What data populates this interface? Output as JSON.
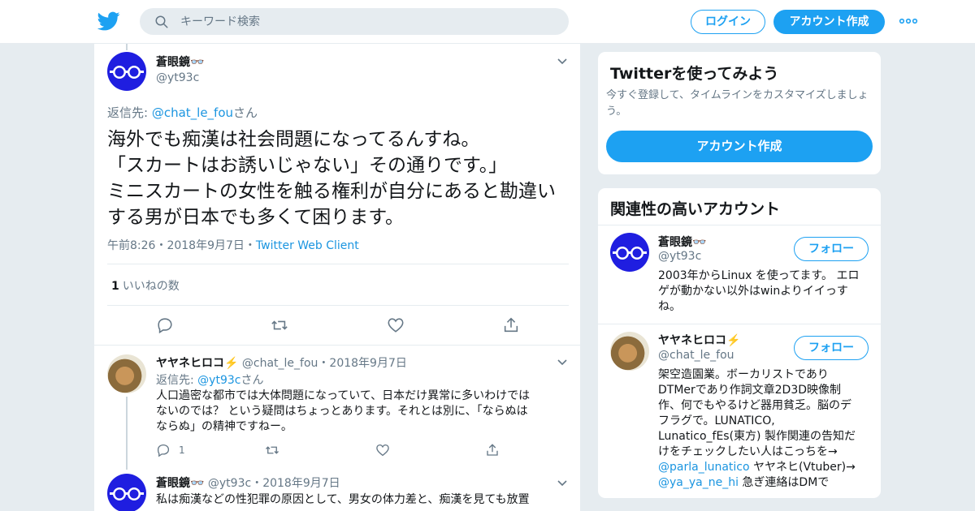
{
  "header": {
    "logo_icon": "twitter-bird-icon",
    "search_placeholder": "キーワード検索",
    "login_label": "ログイン",
    "signup_label": "アカウント作成",
    "more_icon": "more-dots-icon",
    "brand_color": "#1da1f2"
  },
  "tweet": {
    "author_name": "蒼眼鏡👓",
    "author_handle": "@yt93c",
    "reply_prefix": "返信先: ",
    "reply_to": "@chat_le_fou",
    "reply_suffix": "さん",
    "lines": [
      "海外でも痴漢は社会問題になってるんすね。",
      "「スカートはお誘いじゃない」その通りです。」",
      "ミニスカートの女性を触る権利が自分にあると勘違い",
      "する男が日本でも多くて困ります。"
    ],
    "time": "午前8:26",
    "date": "2018年9月7日",
    "dot": "・",
    "client": "Twitter Web Client",
    "likes_count": "1",
    "likes_label": "いいねの数"
  },
  "replies": [
    {
      "author_name": "ヤヤネヒロコ⚡️",
      "author_handle": "@chat_le_fou",
      "dot": "・",
      "date": "2018年9月7日",
      "reply_prefix": "返信先: ",
      "reply_to": "@yt93c",
      "reply_suffix": "さん",
      "lines": [
        "人口過密な都市では大体問題になっていて、日本だけ異常に多いわけでは",
        "ないのでは？ という疑問はちょっとあります。それとは別に、「ならぬは",
        "ならぬ」の精神ですねー。"
      ],
      "reply_count": "1"
    },
    {
      "author_name": "蒼眼鏡👓",
      "author_handle": "@yt93c",
      "dot": "・",
      "date": "2018年9月7日",
      "lines": [
        "私は痴漢などの性犯罪の原因として、男女の体力差と、痴漢を見ても放置"
      ]
    }
  ],
  "sidebar": {
    "signup_card": {
      "title": "Twitterを使ってみよう",
      "subtitle_lines": [
        "今すぐ登録して、タイムラインをカスタマイズしましょ",
        "う。"
      ],
      "button": "アカウント作成"
    },
    "related": {
      "title": "関連性の高いアカウント",
      "follow_label": "フォロー",
      "accounts": [
        {
          "name": "蒼眼鏡👓",
          "handle": "@yt93c",
          "bio_lines": [
            "2003年からLinux を使ってます。 エロ",
            "ゲが動かない以外はwinよりイイっす",
            "ね。"
          ]
        },
        {
          "name": "ヤヤネヒロコ⚡️",
          "handle": "@chat_le_fou",
          "bio_lines": [
            "架空造園業。ボーカリストであり",
            "DTMerであり作詞文章2D3D映像制",
            "作、何でもやるけど器用貧乏。脳のデ",
            "フラグで。LUNATICO,",
            "Lunatico_fEs(東方) 製作関連の告知だ",
            "けをチェックしたい人はこっちを→"
          ],
          "bio_link1": "@parla_lunatico",
          "bio_link1_suffix": " ヤヤネヒ(Vtuber)→",
          "bio_link2": "@ya_ya_ne_hi",
          "bio_link2_suffix": " 急ぎ連絡はDMで"
        }
      ]
    }
  }
}
